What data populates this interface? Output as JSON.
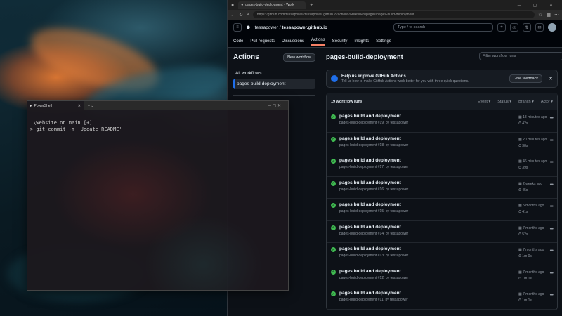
{
  "browser": {
    "tab_title": "pages-build-deployment · Work",
    "url": "https://github.com/tessapower/tessapower.github.io/actions/workflows/pages/pages-build-deployment"
  },
  "github": {
    "owner": "tessapower",
    "repo": "tessapower.github.io",
    "search_placeholder": "Type / to search",
    "nav": [
      "Code",
      "Pull requests",
      "Discussions",
      "Actions",
      "Security",
      "Insights",
      "Settings"
    ],
    "active_nav": "Actions"
  },
  "sidebar": {
    "title": "Actions",
    "new_workflow": "New workflow",
    "items": [
      "All workflows",
      "pages-build-deployment"
    ],
    "management": "Management"
  },
  "main": {
    "title": "pages-build-deployment",
    "filter_placeholder": "Filter workflow runs",
    "banner_title": "Help us improve GitHub Actions",
    "banner_text": "Tell us how to make GitHub Actions work better for you with three quick questions.",
    "feedback": "Give feedback",
    "run_count": "19 workflow runs",
    "filters": [
      "Event",
      "Status",
      "Branch",
      "Actor"
    ],
    "runs": [
      {
        "title": "pages build and deployment",
        "sub": "pages-build-deployment #19: by tessapower",
        "time": "18 minutes ago",
        "dur": "42s"
      },
      {
        "title": "pages build and deployment",
        "sub": "pages-build-deployment #18: by tessapower",
        "time": "20 minutes ago",
        "dur": "38s"
      },
      {
        "title": "pages build and deployment",
        "sub": "pages-build-deployment #17: by tessapower",
        "time": "46 minutes ago",
        "dur": "39s"
      },
      {
        "title": "pages build and deployment",
        "sub": "pages-build-deployment #16: by tessapower",
        "time": "2 weeks ago",
        "dur": "45s"
      },
      {
        "title": "pages build and deployment",
        "sub": "pages-build-deployment #15: by tessapower",
        "time": "5 months ago",
        "dur": "41s"
      },
      {
        "title": "pages build and deployment",
        "sub": "pages-build-deployment #14: by tessapower",
        "time": "7 months ago",
        "dur": "52s"
      },
      {
        "title": "pages build and deployment",
        "sub": "pages-build-deployment #13: by tessapower",
        "time": "7 months ago",
        "dur": "1m 0s"
      },
      {
        "title": "pages build and deployment",
        "sub": "pages-build-deployment #12: by tessapower",
        "time": "7 months ago",
        "dur": "1m 1s"
      },
      {
        "title": "pages build and deployment",
        "sub": "pages-build-deployment #11: by tessapower",
        "time": "7 months ago",
        "dur": "1m 1s"
      }
    ]
  },
  "terminal": {
    "tab_title": "PowerShell",
    "prompt": "…\\website on  main [+]",
    "command": "git commit -m 'Update README'"
  }
}
